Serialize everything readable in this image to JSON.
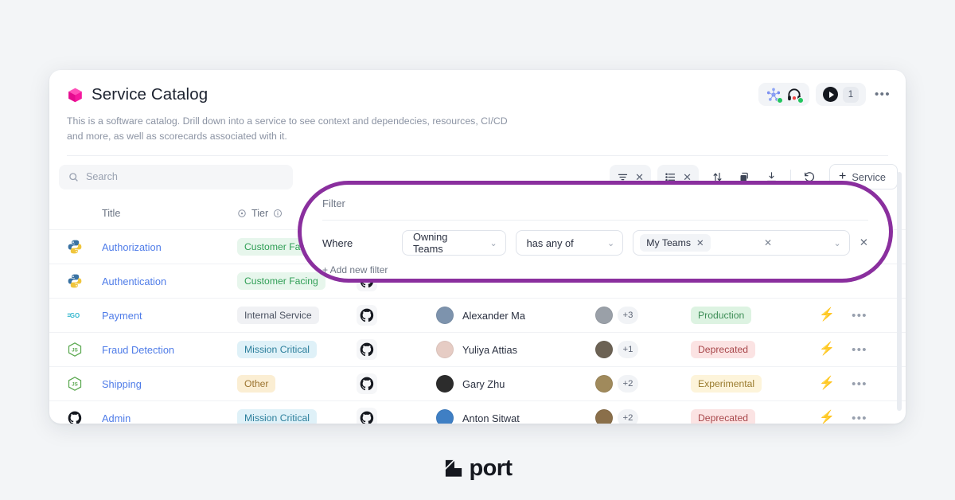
{
  "header": {
    "title": "Service Catalog",
    "subtitle": "This is a software catalog. Drill down into a service to see context and dependecies, resources, CI/CD and more, as well as scorecards associated with it.",
    "cube_icon": "cube-icon",
    "presence": [
      {
        "icon": "molecule-avatar-icon",
        "status_color": "#22c55e"
      },
      {
        "icon": "headphones-avatar-icon",
        "status_color": "#22c55e"
      }
    ],
    "play_label": "play-icon",
    "play_count": "1",
    "more_label": "•••"
  },
  "toolbar": {
    "search_placeholder": "Search",
    "search_value": "",
    "search_icon": "search-icon",
    "filter_chip": {
      "icon": "filter-icon",
      "clear": "✕"
    },
    "group_chip": {
      "icon": "list-icon",
      "clear": "✕"
    },
    "sort_icon": "sort-arrows-icon",
    "copy_icon": "duplicate-icon",
    "download_icon": "download-icon",
    "refresh_icon": "refresh-icon",
    "add_plus": "+",
    "add_label": "Service"
  },
  "table": {
    "columns": {
      "title": "Title",
      "tier": "Tier",
      "tier_prefix_icon": "target-icon",
      "tier_info_icon": "info-icon"
    },
    "rows": [
      {
        "lang": "python-icon",
        "title": "Authorization",
        "tier": "Customer Facing",
        "tier_bg": "#e7f6ec",
        "tier_fg": "#2f9e55",
        "repo": "github-icon",
        "owner": "",
        "owner_avatar": "#6f8ba8",
        "extra": "",
        "extra_avatar": "#8d949e",
        "status": "",
        "status_bg": "",
        "status_fg": "",
        "bolt": "",
        "more": ""
      },
      {
        "lang": "python-icon",
        "title": "Authentication",
        "tier": "Customer Facing",
        "tier_bg": "#e7f6ec",
        "tier_fg": "#2f9e55",
        "repo": "github-icon",
        "owner": "",
        "owner_avatar": "#6f8ba8",
        "extra": "",
        "extra_avatar": "#8d949e",
        "status": "",
        "status_bg": "",
        "status_fg": "",
        "bolt": "",
        "more": ""
      },
      {
        "lang": "go-icon",
        "title": "Payment",
        "tier": "Internal Service",
        "tier_bg": "#f0f1f4",
        "tier_fg": "#4a5160",
        "repo": "github-icon",
        "owner": "Alexander Ma",
        "owner_avatar": "#7d93ad",
        "extra": "+3",
        "extra_avatar": "#9aa0a8",
        "status": "Production",
        "status_bg": "#ddf3e2",
        "status_fg": "#3d8d56",
        "bolt": "⚡",
        "more": "•••"
      },
      {
        "lang": "nodejs-icon",
        "title": "Fraud Detection",
        "tier": "Mission Critical",
        "tier_bg": "#dff1f8",
        "tier_fg": "#2c7f9c",
        "repo": "github-icon",
        "owner": "Yuliya Attias",
        "owner_avatar": "#e6ccc4",
        "extra": "+1",
        "extra_avatar": "#6c6254",
        "status": "Deprecated",
        "status_bg": "#fbe3e3",
        "status_fg": "#a8474b",
        "bolt": "⚡",
        "more": "•••"
      },
      {
        "lang": "nodejs-icon",
        "title": "Shipping",
        "tier": "Other",
        "tier_bg": "#fbeed3",
        "tier_fg": "#9c7430",
        "repo": "github-icon",
        "owner": "Gary Zhu",
        "owner_avatar": "#2c2c2c",
        "extra": "+2",
        "extra_avatar": "#a08a5c",
        "status": "Experimental",
        "status_bg": "#fdf4da",
        "status_fg": "#9a7b2e",
        "bolt": "⚡",
        "more": "•••"
      },
      {
        "lang": "github-icon",
        "title": "Admin",
        "tier": "Mission Critical",
        "tier_bg": "#dff1f8",
        "tier_fg": "#2c7f9c",
        "repo": "github-icon",
        "owner": "Anton Sitwat",
        "owner_avatar": "#3f7fc4",
        "extra": "+2",
        "extra_avatar": "#8a6f4a",
        "status": "Deprecated",
        "status_bg": "#fbe3e3",
        "status_fg": "#a8474b",
        "bolt": "⚡",
        "more": "•••"
      }
    ]
  },
  "filter": {
    "ring_color": "#8a2f9e",
    "panel_title": "Filter",
    "where_label": "Where",
    "property_value": "Owning Teams",
    "operator_value": "has any of",
    "value_chip": "My Teams",
    "chip_remove": "✕",
    "value_clear": "✕",
    "row_remove": "✕",
    "chevron": "⌄",
    "add_new_filter": "+ Add new filter"
  },
  "footer": {
    "brand_mark": "port-arrow-icon",
    "brand_word": "port"
  }
}
